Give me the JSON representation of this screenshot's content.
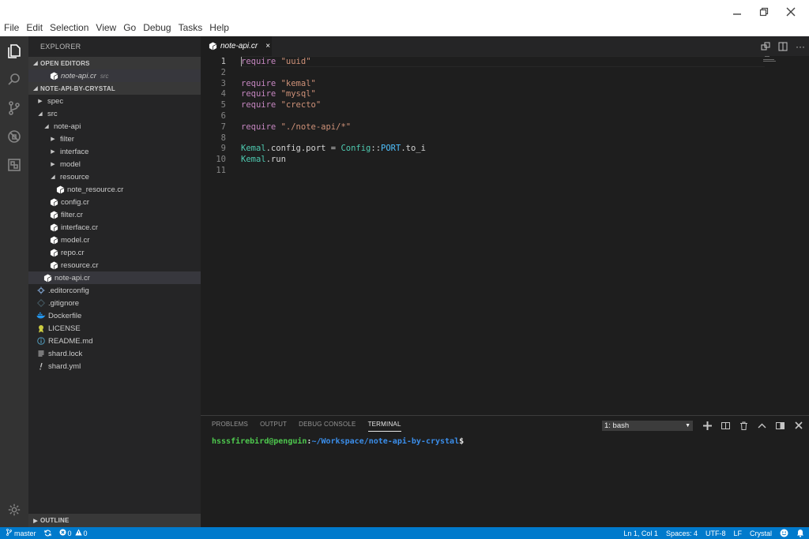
{
  "menu": [
    "File",
    "Edit",
    "Selection",
    "View",
    "Go",
    "Debug",
    "Tasks",
    "Help"
  ],
  "window_controls": [
    "minimize-icon",
    "restore-icon",
    "close-icon"
  ],
  "activity_bar": [
    "files-icon",
    "search-icon",
    "source-control-icon",
    "debug-icon",
    "extensions-icon",
    "settings-icon"
  ],
  "sidebar": {
    "title": "EXPLORER",
    "open_editors_label": "OPEN EDITORS",
    "open_editor": {
      "name": "note-api.cr",
      "folder": "src"
    },
    "project_label": "NOTE-API-BY-CRYSTAL",
    "tree": [
      {
        "label": "spec",
        "type": "folder",
        "state": "collapsed",
        "depth": 1
      },
      {
        "label": "src",
        "type": "folder",
        "state": "expanded",
        "depth": 1
      },
      {
        "label": "note-api",
        "type": "folder",
        "state": "expanded",
        "depth": 2
      },
      {
        "label": "filter",
        "type": "folder",
        "state": "collapsed",
        "depth": 3
      },
      {
        "label": "interface",
        "type": "folder",
        "state": "collapsed",
        "depth": 3
      },
      {
        "label": "model",
        "type": "folder",
        "state": "collapsed",
        "depth": 3
      },
      {
        "label": "resource",
        "type": "folder",
        "state": "expanded",
        "depth": 3
      },
      {
        "label": "note_resource.cr",
        "type": "crystal",
        "depth": 4
      },
      {
        "label": "config.cr",
        "type": "crystal",
        "depth": 3
      },
      {
        "label": "filter.cr",
        "type": "crystal",
        "depth": 3
      },
      {
        "label": "interface.cr",
        "type": "crystal",
        "depth": 3
      },
      {
        "label": "model.cr",
        "type": "crystal",
        "depth": 3
      },
      {
        "label": "repo.cr",
        "type": "crystal",
        "depth": 3
      },
      {
        "label": "resource.cr",
        "type": "crystal",
        "depth": 3
      },
      {
        "label": "note-api.cr",
        "type": "crystal",
        "depth": 2,
        "selected": true
      },
      {
        "label": ".editorconfig",
        "type": "editorconfig",
        "depth": 1
      },
      {
        "label": ".gitignore",
        "type": "git",
        "depth": 1
      },
      {
        "label": "Dockerfile",
        "type": "docker",
        "depth": 1
      },
      {
        "label": "LICENSE",
        "type": "license",
        "depth": 1
      },
      {
        "label": "README.md",
        "type": "info",
        "depth": 1
      },
      {
        "label": "shard.lock",
        "type": "lines",
        "depth": 1
      },
      {
        "label": "shard.yml",
        "type": "yaml",
        "depth": 1
      }
    ],
    "outline_label": "OUTLINE"
  },
  "editor": {
    "tab": {
      "name": "note-api.cr",
      "close": "×"
    },
    "lines": [
      {
        "n": "1",
        "tokens": [
          [
            "kw",
            "require"
          ],
          [
            "plain",
            " "
          ],
          [
            "str",
            "\"uuid\""
          ]
        ]
      },
      {
        "n": "2",
        "tokens": []
      },
      {
        "n": "3",
        "tokens": [
          [
            "kw",
            "require"
          ],
          [
            "plain",
            " "
          ],
          [
            "str",
            "\"kemal\""
          ]
        ]
      },
      {
        "n": "4",
        "tokens": [
          [
            "kw",
            "require"
          ],
          [
            "plain",
            " "
          ],
          [
            "str",
            "\"mysql\""
          ]
        ]
      },
      {
        "n": "5",
        "tokens": [
          [
            "kw",
            "require"
          ],
          [
            "plain",
            " "
          ],
          [
            "str",
            "\"crecto\""
          ]
        ]
      },
      {
        "n": "6",
        "tokens": []
      },
      {
        "n": "7",
        "tokens": [
          [
            "kw",
            "require"
          ],
          [
            "plain",
            " "
          ],
          [
            "str",
            "\"./note-api/*\""
          ]
        ]
      },
      {
        "n": "8",
        "tokens": []
      },
      {
        "n": "9",
        "tokens": [
          [
            "cls",
            "Kemal"
          ],
          [
            "plain",
            ".config.port = "
          ],
          [
            "cls",
            "Config"
          ],
          [
            "plain",
            "::"
          ],
          [
            "const",
            "PORT"
          ],
          [
            "plain",
            ".to_i"
          ]
        ]
      },
      {
        "n": "10",
        "tokens": [
          [
            "cls",
            "Kemal"
          ],
          [
            "plain",
            ".run"
          ]
        ]
      },
      {
        "n": "11",
        "tokens": []
      }
    ]
  },
  "panel": {
    "tabs": [
      "PROBLEMS",
      "OUTPUT",
      "DEBUG CONSOLE",
      "TERMINAL"
    ],
    "active_tab": "TERMINAL",
    "terminal_select": "1: bash",
    "prompt_user": "hsssfirebird@penguin",
    "prompt_sep": ":",
    "prompt_path": "~/Workspace/note-api-by-crystal",
    "prompt_dollar": "$"
  },
  "statusbar": {
    "branch": "master",
    "errors": "0",
    "warnings": "0",
    "position": "Ln 1, Col 1",
    "spaces": "Spaces: 4",
    "encoding": "UTF-8",
    "eol": "LF",
    "language": "Crystal"
  }
}
